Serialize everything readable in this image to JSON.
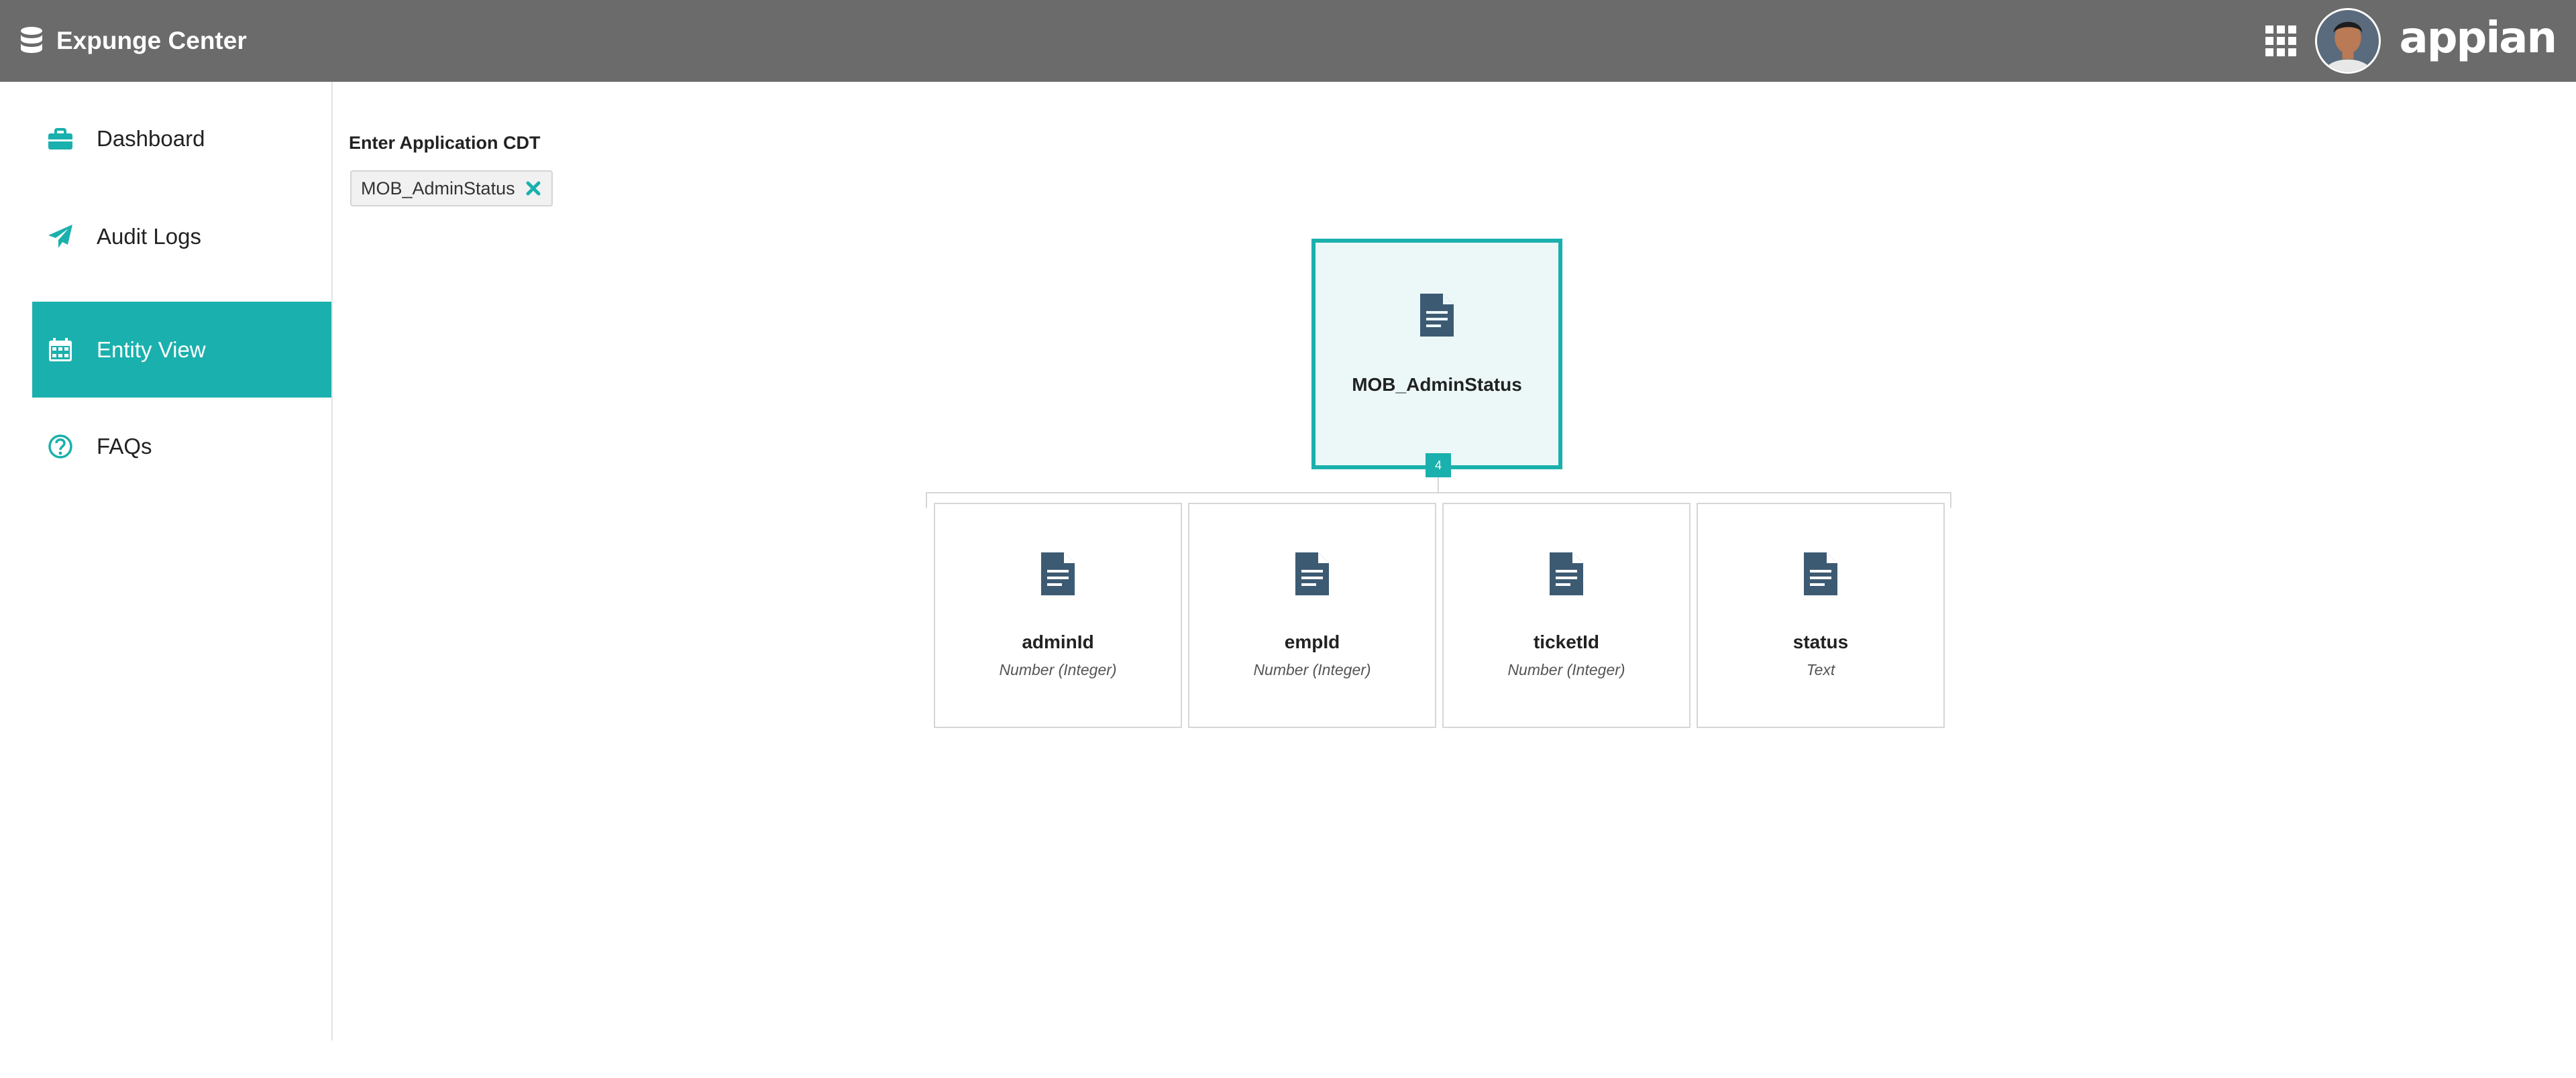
{
  "header": {
    "title": "Expunge Center",
    "logo_text": "appian",
    "brand_icon": "database-icon",
    "apps_icon": "grid-icon"
  },
  "sidebar": {
    "items": [
      {
        "label": "Dashboard",
        "icon": "briefcase-icon",
        "active": false
      },
      {
        "label": "Audit Logs",
        "icon": "paper-plane-icon",
        "active": false
      },
      {
        "label": "Entity View",
        "icon": "calendar-icon",
        "active": true
      },
      {
        "label": "FAQs",
        "icon": "question-circle-icon",
        "active": false
      }
    ]
  },
  "main": {
    "field_label": "Enter Application CDT",
    "selected_token": "MOB_AdminStatus",
    "root": {
      "name": "MOB_AdminStatus",
      "child_count": "4"
    },
    "children": [
      {
        "name": "adminId",
        "type": "Number (Integer)"
      },
      {
        "name": "empId",
        "type": "Number (Integer)"
      },
      {
        "name": "ticketId",
        "type": "Number (Integer)"
      },
      {
        "name": "status",
        "type": "Text"
      }
    ]
  },
  "colors": {
    "accent": "#1ab0ad",
    "header_bg": "#6b6b6b",
    "doc_icon": "#3d5a73"
  }
}
